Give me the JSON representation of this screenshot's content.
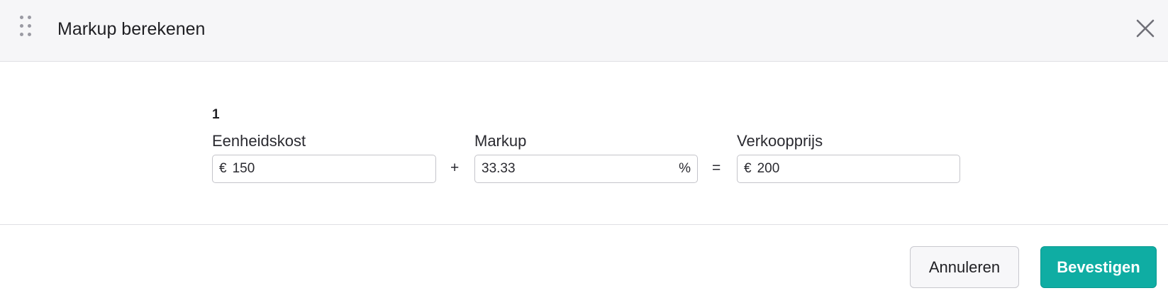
{
  "dialog": {
    "title": "Markup berekenen",
    "close_icon": "close-icon",
    "drag_icon": "drag-handle-icon"
  },
  "calculator": {
    "row_number": "1",
    "unit_cost": {
      "label": "Eenheidskost",
      "prefix": "€",
      "value": "150"
    },
    "plus_operator": "+",
    "markup": {
      "label": "Markup",
      "value": "33.33",
      "suffix": "%"
    },
    "equals_operator": "=",
    "sale_price": {
      "label": "Verkoopprijs",
      "prefix": "€",
      "value": "200"
    }
  },
  "footer": {
    "cancel_label": "Annuleren",
    "confirm_label": "Bevestigen"
  },
  "colors": {
    "accent": "#0fada3",
    "header_bg": "#f6f6f8"
  }
}
